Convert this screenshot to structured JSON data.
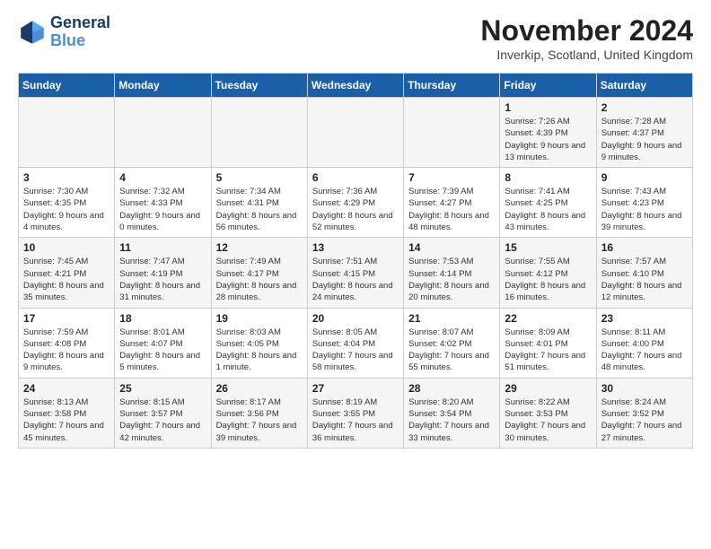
{
  "logo": {
    "line1": "General",
    "line2": "Blue"
  },
  "title": "November 2024",
  "location": "Inverkip, Scotland, United Kingdom",
  "headers": [
    "Sunday",
    "Monday",
    "Tuesday",
    "Wednesday",
    "Thursday",
    "Friday",
    "Saturday"
  ],
  "weeks": [
    [
      {
        "day": "",
        "info": ""
      },
      {
        "day": "",
        "info": ""
      },
      {
        "day": "",
        "info": ""
      },
      {
        "day": "",
        "info": ""
      },
      {
        "day": "",
        "info": ""
      },
      {
        "day": "1",
        "info": "Sunrise: 7:26 AM\nSunset: 4:39 PM\nDaylight: 9 hours and 13 minutes."
      },
      {
        "day": "2",
        "info": "Sunrise: 7:28 AM\nSunset: 4:37 PM\nDaylight: 9 hours and 9 minutes."
      }
    ],
    [
      {
        "day": "3",
        "info": "Sunrise: 7:30 AM\nSunset: 4:35 PM\nDaylight: 9 hours and 4 minutes."
      },
      {
        "day": "4",
        "info": "Sunrise: 7:32 AM\nSunset: 4:33 PM\nDaylight: 9 hours and 0 minutes."
      },
      {
        "day": "5",
        "info": "Sunrise: 7:34 AM\nSunset: 4:31 PM\nDaylight: 8 hours and 56 minutes."
      },
      {
        "day": "6",
        "info": "Sunrise: 7:36 AM\nSunset: 4:29 PM\nDaylight: 8 hours and 52 minutes."
      },
      {
        "day": "7",
        "info": "Sunrise: 7:39 AM\nSunset: 4:27 PM\nDaylight: 8 hours and 48 minutes."
      },
      {
        "day": "8",
        "info": "Sunrise: 7:41 AM\nSunset: 4:25 PM\nDaylight: 8 hours and 43 minutes."
      },
      {
        "day": "9",
        "info": "Sunrise: 7:43 AM\nSunset: 4:23 PM\nDaylight: 8 hours and 39 minutes."
      }
    ],
    [
      {
        "day": "10",
        "info": "Sunrise: 7:45 AM\nSunset: 4:21 PM\nDaylight: 8 hours and 35 minutes."
      },
      {
        "day": "11",
        "info": "Sunrise: 7:47 AM\nSunset: 4:19 PM\nDaylight: 8 hours and 31 minutes."
      },
      {
        "day": "12",
        "info": "Sunrise: 7:49 AM\nSunset: 4:17 PM\nDaylight: 8 hours and 28 minutes."
      },
      {
        "day": "13",
        "info": "Sunrise: 7:51 AM\nSunset: 4:15 PM\nDaylight: 8 hours and 24 minutes."
      },
      {
        "day": "14",
        "info": "Sunrise: 7:53 AM\nSunset: 4:14 PM\nDaylight: 8 hours and 20 minutes."
      },
      {
        "day": "15",
        "info": "Sunrise: 7:55 AM\nSunset: 4:12 PM\nDaylight: 8 hours and 16 minutes."
      },
      {
        "day": "16",
        "info": "Sunrise: 7:57 AM\nSunset: 4:10 PM\nDaylight: 8 hours and 12 minutes."
      }
    ],
    [
      {
        "day": "17",
        "info": "Sunrise: 7:59 AM\nSunset: 4:08 PM\nDaylight: 8 hours and 9 minutes."
      },
      {
        "day": "18",
        "info": "Sunrise: 8:01 AM\nSunset: 4:07 PM\nDaylight: 8 hours and 5 minutes."
      },
      {
        "day": "19",
        "info": "Sunrise: 8:03 AM\nSunset: 4:05 PM\nDaylight: 8 hours and 1 minute."
      },
      {
        "day": "20",
        "info": "Sunrise: 8:05 AM\nSunset: 4:04 PM\nDaylight: 7 hours and 58 minutes."
      },
      {
        "day": "21",
        "info": "Sunrise: 8:07 AM\nSunset: 4:02 PM\nDaylight: 7 hours and 55 minutes."
      },
      {
        "day": "22",
        "info": "Sunrise: 8:09 AM\nSunset: 4:01 PM\nDaylight: 7 hours and 51 minutes."
      },
      {
        "day": "23",
        "info": "Sunrise: 8:11 AM\nSunset: 4:00 PM\nDaylight: 7 hours and 48 minutes."
      }
    ],
    [
      {
        "day": "24",
        "info": "Sunrise: 8:13 AM\nSunset: 3:58 PM\nDaylight: 7 hours and 45 minutes."
      },
      {
        "day": "25",
        "info": "Sunrise: 8:15 AM\nSunset: 3:57 PM\nDaylight: 7 hours and 42 minutes."
      },
      {
        "day": "26",
        "info": "Sunrise: 8:17 AM\nSunset: 3:56 PM\nDaylight: 7 hours and 39 minutes."
      },
      {
        "day": "27",
        "info": "Sunrise: 8:19 AM\nSunset: 3:55 PM\nDaylight: 7 hours and 36 minutes."
      },
      {
        "day": "28",
        "info": "Sunrise: 8:20 AM\nSunset: 3:54 PM\nDaylight: 7 hours and 33 minutes."
      },
      {
        "day": "29",
        "info": "Sunrise: 8:22 AM\nSunset: 3:53 PM\nDaylight: 7 hours and 30 minutes."
      },
      {
        "day": "30",
        "info": "Sunrise: 8:24 AM\nSunset: 3:52 PM\nDaylight: 7 hours and 27 minutes."
      }
    ]
  ]
}
